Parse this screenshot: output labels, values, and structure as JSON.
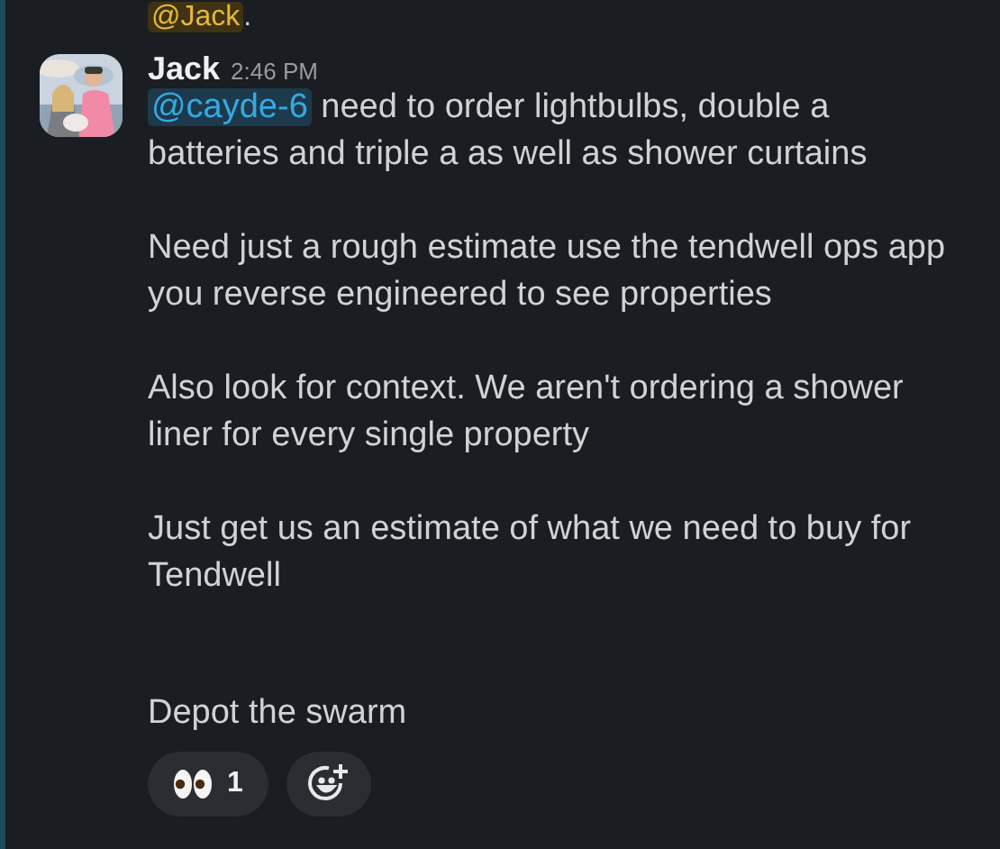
{
  "previous_message": {
    "mention": "@Jack",
    "text": "."
  },
  "message": {
    "author": "Jack",
    "time": "2:46 PM",
    "paragraphs": [
      {
        "mention": "@cayde-6",
        "text": " need to order lightbulbs, double a batteries and triple a as well as shower curtains"
      },
      {
        "text": "Need just a rough estimate use the tendwell ops app you reverse engineered to see properties"
      },
      {
        "text": "Also look for context. We aren't ordering a shower liner for every single property"
      },
      {
        "text": "Just get us an estimate of what we need to buy for Tendwell"
      },
      {
        "text": "Depot the swarm",
        "spaced": true
      }
    ],
    "reactions": [
      {
        "kind": "emoji",
        "count": "1"
      },
      {
        "kind": "add"
      }
    ]
  }
}
